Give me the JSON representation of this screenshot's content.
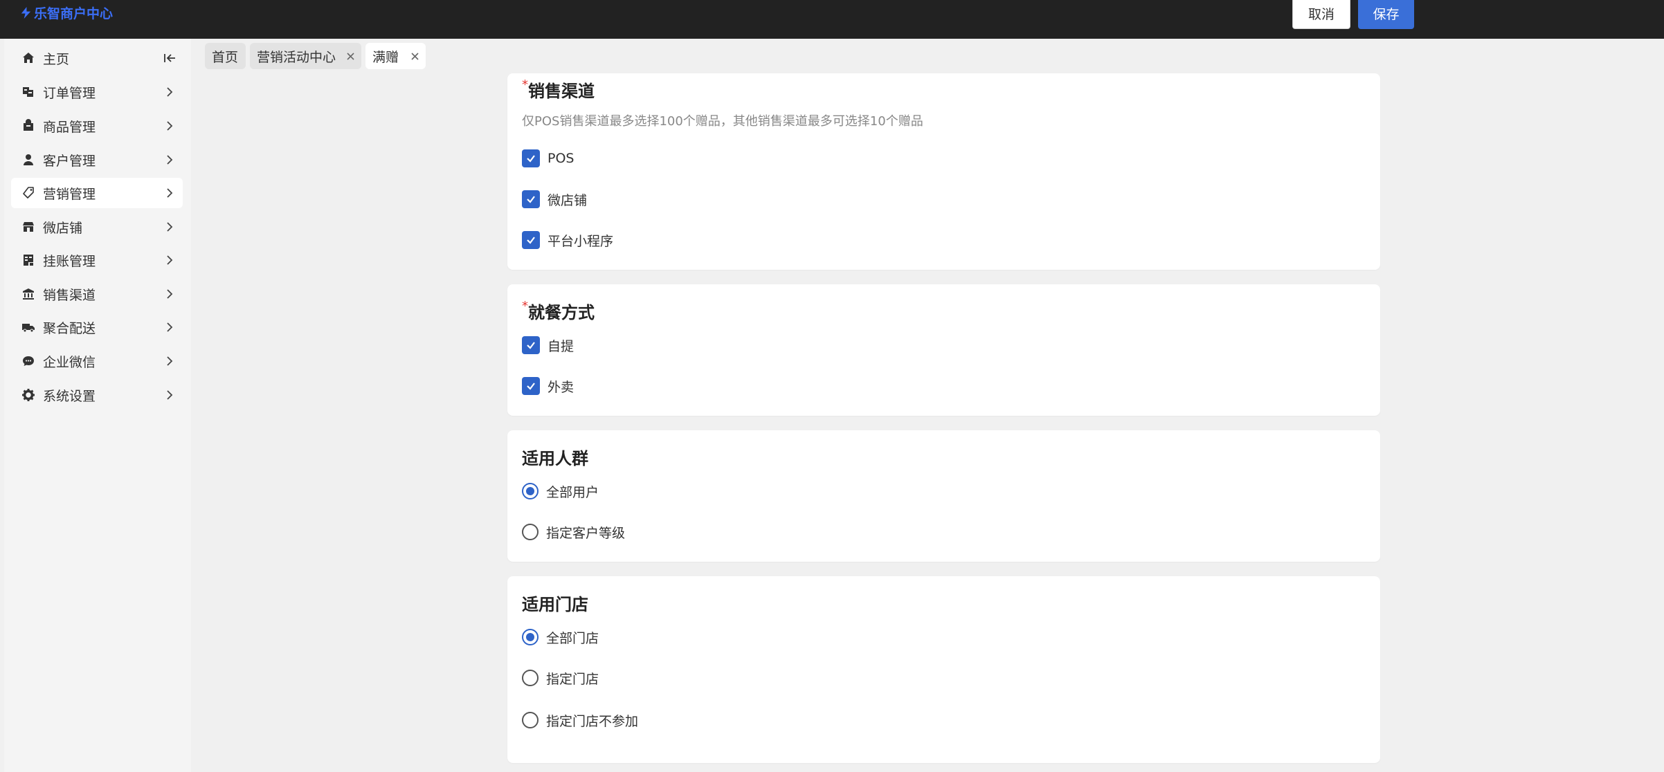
{
  "app": {
    "title": "乐智商户中心"
  },
  "header": {
    "cancel_label": "取消",
    "save_label": "保存"
  },
  "sidebar": {
    "items": [
      {
        "label": "主页",
        "icon": "home-icon"
      },
      {
        "label": "订单管理",
        "icon": "order-icon"
      },
      {
        "label": "商品管理",
        "icon": "goods-icon"
      },
      {
        "label": "客户管理",
        "icon": "user-icon"
      },
      {
        "label": "营销管理",
        "icon": "tag-icon"
      },
      {
        "label": "微店铺",
        "icon": "store-icon"
      },
      {
        "label": "挂账管理",
        "icon": "ledger-icon"
      },
      {
        "label": "销售渠道",
        "icon": "bank-icon"
      },
      {
        "label": "聚合配送",
        "icon": "truck-icon"
      },
      {
        "label": "企业微信",
        "icon": "chat-icon"
      },
      {
        "label": "系统设置",
        "icon": "gear-icon"
      }
    ],
    "active_index": 4
  },
  "tabs": [
    {
      "label": "首页"
    },
    {
      "label": "营销活动中心"
    },
    {
      "label": "满赠"
    }
  ],
  "sections": {
    "sales_channel": {
      "required_mark": "*",
      "title": "销售渠道",
      "hint": "仅POS销售渠道最多选择100个赠品，其他销售渠道最多可选择10个赠品",
      "options": [
        {
          "label": "POS",
          "checked": true
        },
        {
          "label": "微店铺",
          "checked": true
        },
        {
          "label": "平台小程序",
          "checked": true
        }
      ]
    },
    "dining_mode": {
      "required_mark": "*",
      "title": "就餐方式",
      "options": [
        {
          "label": "自提",
          "checked": true
        },
        {
          "label": "外卖",
          "checked": true
        }
      ]
    },
    "audience": {
      "title": "适用人群",
      "options": [
        {
          "label": "全部用户",
          "selected": true
        },
        {
          "label": "指定客户等级",
          "selected": false
        }
      ]
    },
    "stores": {
      "title": "适用门店",
      "options": [
        {
          "label": "全部门店",
          "selected": true
        },
        {
          "label": "指定门店",
          "selected": false
        },
        {
          "label": "指定门店不参加",
          "selected": false
        }
      ]
    }
  },
  "colors": {
    "primary": "#3a6fd8",
    "checkbox": "#2e63c8",
    "topbar": "#222222",
    "logo": "#3b6ef5",
    "required": "#e53935"
  }
}
